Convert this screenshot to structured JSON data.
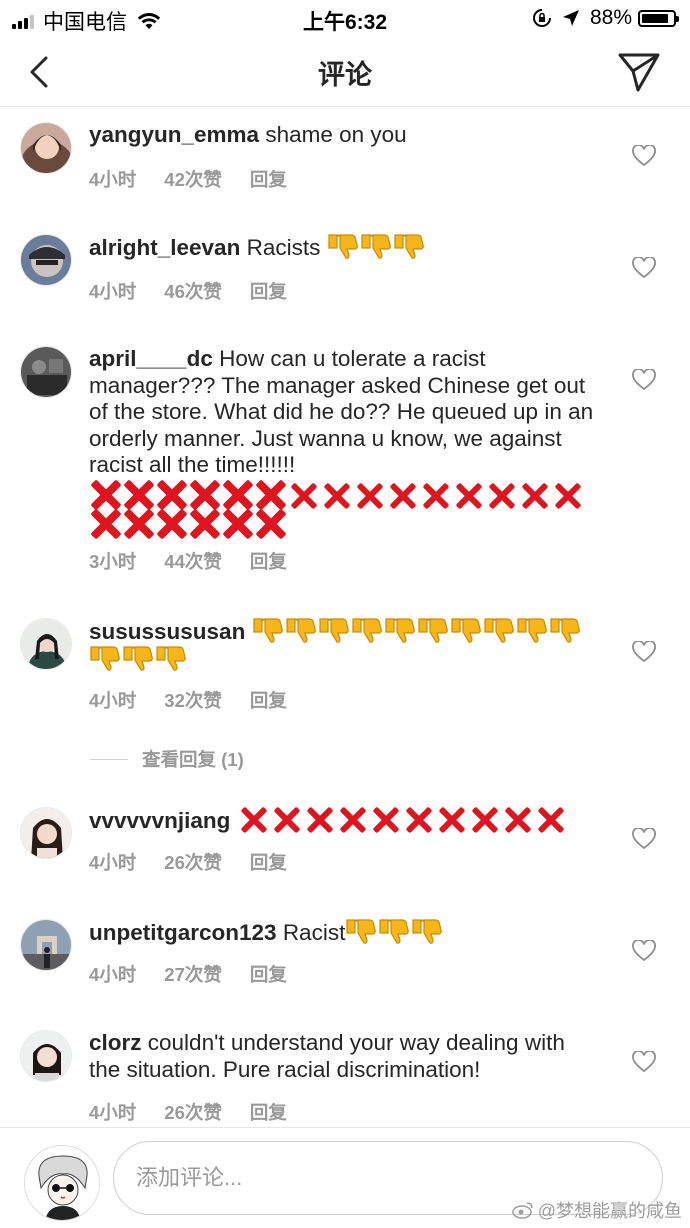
{
  "status_bar": {
    "carrier": "中国电信",
    "time": "上午6:32",
    "battery": "88%",
    "battery_level": 0.88
  },
  "header": {
    "title": "评论"
  },
  "comments": [
    {
      "username": "yangyun_emma",
      "text": "shame on you",
      "time": "4小时",
      "likes": "42次赞",
      "reply": "回复"
    },
    {
      "username": "alright_leevan",
      "text": "Racists",
      "emoji": "thumbs-down x3",
      "time": "4小时",
      "likes": "46次赞",
      "reply": "回复"
    },
    {
      "username": "april____dc",
      "text": "How can u tolerate a racist manager??? The manager asked Chinese get out of the store.  What did he do?? He queued up in an orderly manner.  Just wanna u know, we against racist all the time!!!!!!",
      "emoji": "cross-mark x20",
      "time": "3小时",
      "likes": "44次赞",
      "reply": "回复"
    },
    {
      "username": "susussususan",
      "emoji": "thumbs-down x13",
      "time": "4小时",
      "likes": "32次赞",
      "reply": "回复",
      "view_replies": "查看回复 (1)"
    },
    {
      "username": "vvvvvvnjiang",
      "emoji": "cross-mark x10",
      "time": "4小时",
      "likes": "26次赞",
      "reply": "回复"
    },
    {
      "username": "unpetitgarcon123",
      "text": "Racist",
      "emoji": "thumbs-down x3",
      "time": "4小时",
      "likes": "27次赞",
      "reply": "回复"
    },
    {
      "username": "clorz",
      "text": "couldn't understand your way dealing with the situation. Pure racial discrimination!",
      "time": "4小时",
      "likes": "26次赞",
      "reply": "回复"
    }
  ],
  "footer": {
    "input_placeholder": "添加评论..."
  },
  "watermark": "@梦想能赢的咸鱼",
  "colors": {
    "text": "#262626",
    "meta": "#999999",
    "cross": "#e0141e",
    "thumb": "#f6b619"
  }
}
